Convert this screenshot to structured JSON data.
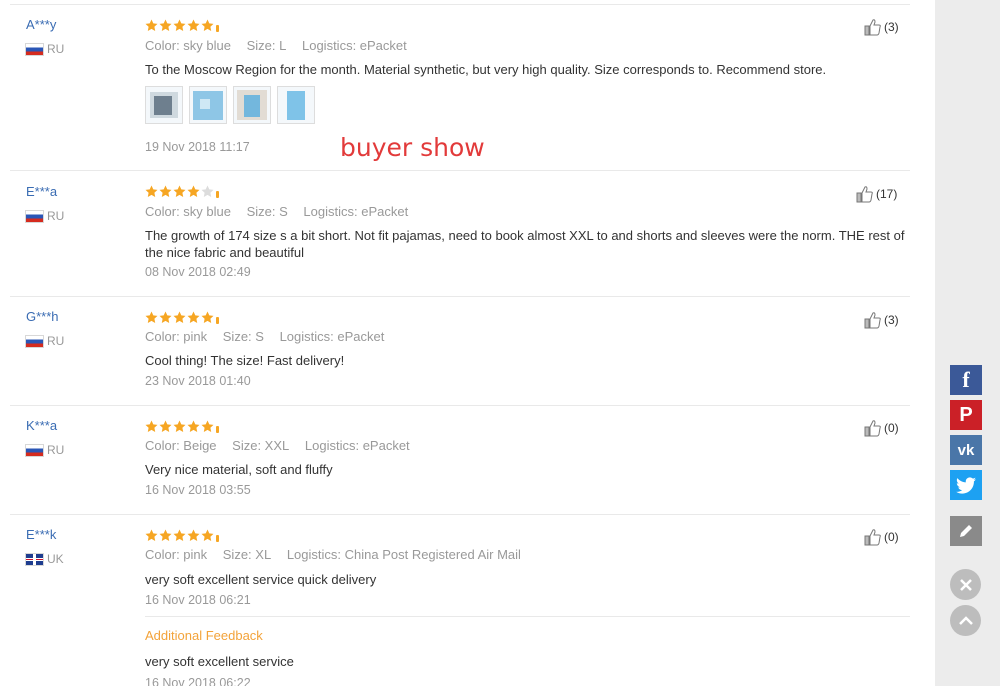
{
  "reviews": [
    {
      "name": "A***y",
      "country": "RU",
      "flag": "russia-flag",
      "rating": 5,
      "color": "Color: sky blue",
      "size": "Size: L",
      "logistics": "Logistics: ePacket",
      "text": "To the Moscow Region for the month. Material synthetic, but very high quality. Size corresponds to. Recommend store.",
      "date": "19 Nov 2018 11:17",
      "likes": "(3)"
    },
    {
      "name": "E***a",
      "country": "RU",
      "flag": "russia-flag",
      "rating": 4,
      "color": "Color: sky blue",
      "size": "Size: S",
      "logistics": "Logistics: ePacket",
      "text": "The growth of 174 size s a bit short. Not fit pajamas, need to book almost XXL to and shorts and sleeves were the norm. THE rest of the nice fabric and beautiful",
      "date": "08 Nov 2018 02:49",
      "likes": "(17)"
    },
    {
      "name": "G***h",
      "country": "RU",
      "flag": "russia-flag",
      "rating": 5,
      "color": "Color: pink",
      "size": "Size: S",
      "logistics": "Logistics: ePacket",
      "text": "Cool thing! The size! Fast delivery!",
      "date": "23 Nov 2018 01:40",
      "likes": "(3)"
    },
    {
      "name": "K***a",
      "country": "RU",
      "flag": "russia-flag",
      "rating": 5,
      "color": "Color: Beige",
      "size": "Size: XXL",
      "logistics": "Logistics: ePacket",
      "text": "Very nice material, soft and fluffy",
      "date": "16 Nov 2018 03:55",
      "likes": "(0)"
    },
    {
      "name": "E***k",
      "country": "UK",
      "flag": "uk-flag",
      "rating": 5,
      "color": "Color: pink",
      "size": "Size: XL",
      "logistics": "Logistics: China Post Registered Air Mail",
      "text": "very soft excellent service quick delivery",
      "date": "16 Nov 2018 06:21",
      "likes": "(0)",
      "additional_label": "Additional Feedback",
      "additional_text": "very soft excellent service",
      "additional_date": "16 Nov 2018 06:22"
    }
  ],
  "annotation": "buyer show",
  "review_photos": [
    "photo-1",
    "photo-2",
    "photo-3",
    "photo-4"
  ],
  "share": {
    "facebook": "f",
    "pinterest": "P",
    "vk": "vk",
    "twitter_icon": "twitter-icon",
    "edit_icon": "pencil-icon",
    "close_icon": "close-icon",
    "up_icon": "arrow-up-icon",
    "colors": {
      "facebook": "#3b5998",
      "pinterest": "#cb2027",
      "vk": "#4a76a8",
      "twitter": "#1da1f2",
      "edit": "#8a8a8a"
    }
  },
  "colors": {
    "star": "#f6a623",
    "name": "#3a6cb3",
    "annotation": "#e23a3a",
    "additional": "#f3a33a"
  }
}
